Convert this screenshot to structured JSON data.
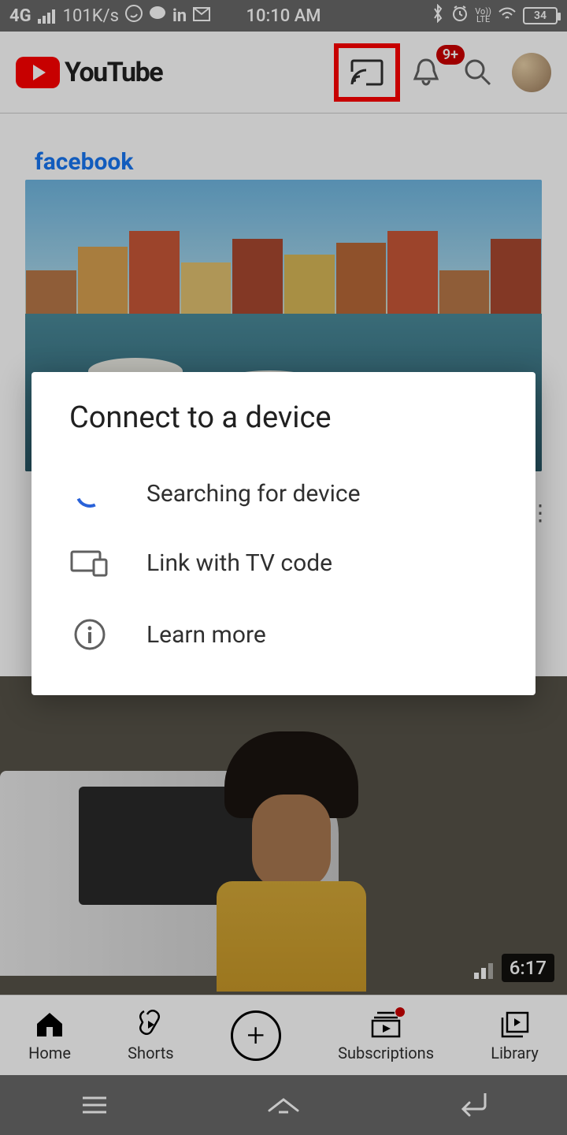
{
  "status": {
    "network": "4G",
    "speed": "101K/s",
    "time": "10:10 AM",
    "lte": "LTE",
    "battery": "34"
  },
  "header": {
    "title": "YouTube",
    "badge": "9+"
  },
  "feed": {
    "sponsor": "facebook",
    "video2_duration": "6:17"
  },
  "dialog": {
    "title": "Connect to a device",
    "row1": "Searching for device",
    "row2": "Link with TV code",
    "row3": "Learn more"
  },
  "nav": {
    "home": "Home",
    "shorts": "Shorts",
    "subs": "Subscriptions",
    "library": "Library"
  }
}
